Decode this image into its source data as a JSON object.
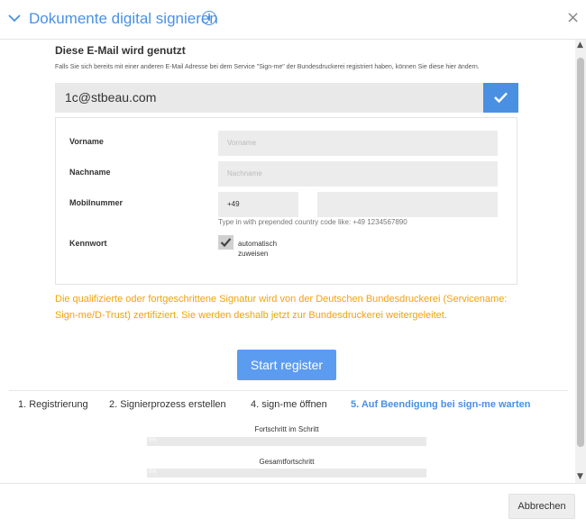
{
  "header": {
    "title": "Dokumente digital signieren",
    "info_glyph": "i",
    "close_glyph": "×"
  },
  "email": {
    "heading": "Diese E-Mail wird genutzt",
    "description": "Falls Sie sich bereits mit einer anderen E-Mail Adresse bei dem Service \"Sign-me\" der Bundesdruckerei registriert haben, können Sie diese hier ändern.",
    "value": "1c@stbeau.com"
  },
  "form": {
    "first_name": {
      "label": "Vorname",
      "placeholder": "Vorname"
    },
    "last_name": {
      "label": "Nachname",
      "placeholder": "Nachname"
    },
    "mobile": {
      "label": "Mobilnummer",
      "prefix": "+49",
      "hint": "Type in with prepended country code like: +49 1234567890"
    },
    "password": {
      "label": "Kennwort",
      "checkbox_label": "automatisch zuweisen"
    }
  },
  "notice": "Die qualifizierte oder fortgeschrittene Signatur wird von der Deutschen Bundesdruckerei (Servicename: Sign-me/D-Trust) zertifiziert. Sie werden deshalb jetzt zur Bundesdruckerei weitergeleitet.",
  "start_button": "Start register",
  "steps": [
    "1. Registrierung",
    "2. Signierprozess erstellen",
    "4. sign-me öffnen",
    "5. Auf Beendigung bei sign-me warten"
  ],
  "progress": {
    "step_label": "Fortschritt im Schritt",
    "step_value": "0%",
    "step_fraction": 0,
    "total_label": "Gesamtfortschritt",
    "total_value": "0%",
    "total_fraction": 0
  },
  "footer": {
    "cancel": "Abbrechen"
  },
  "colors": {
    "accent": "#4a90e2",
    "notice": "#f0a30a",
    "button": "#5b9cf0"
  }
}
